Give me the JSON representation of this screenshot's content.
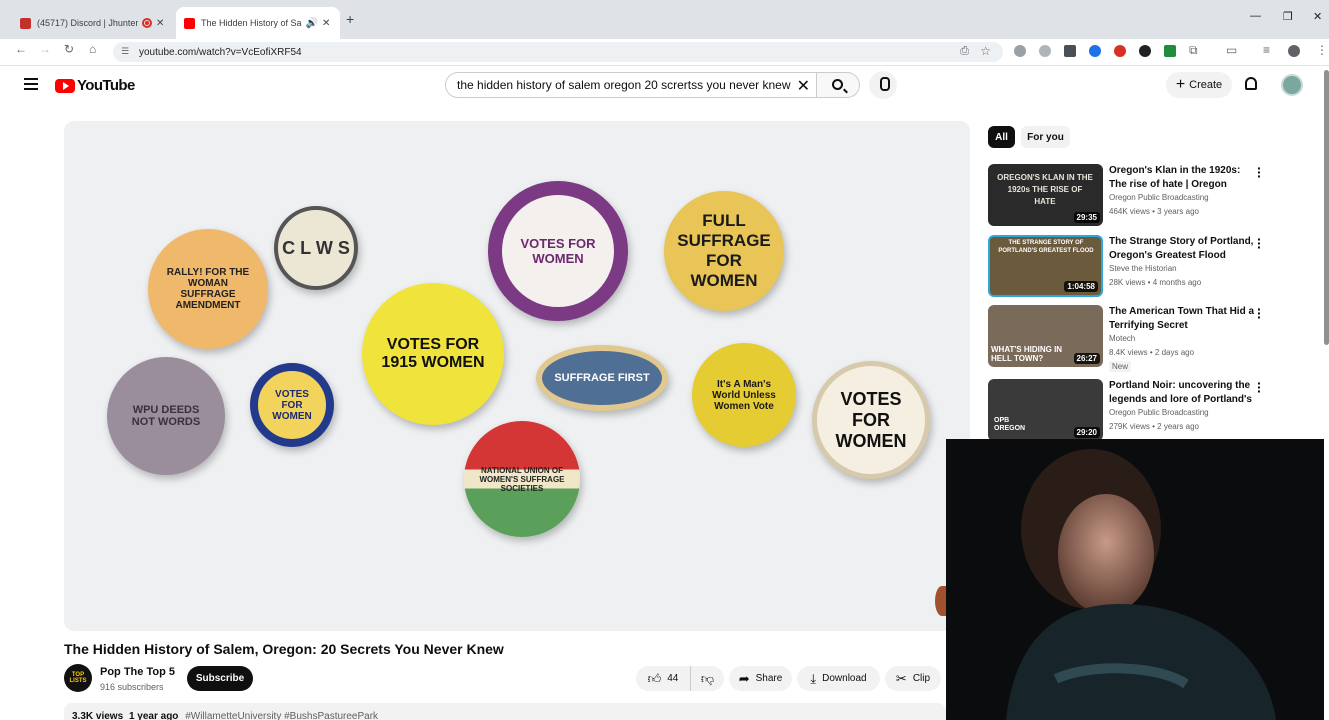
{
  "browser": {
    "tabs": [
      {
        "title": "(45717) Discord | Jhunter, R",
        "active": false
      },
      {
        "title": "The Hidden History of Sale",
        "active": true
      }
    ],
    "url": "youtube.com/watch?v=VcEofiXRF54"
  },
  "header": {
    "logo_text": "YouTube",
    "search_query": "the hidden history of salem oregon 20 scrertss you never knew",
    "create_label": "Create"
  },
  "player": {
    "badges": {
      "rally": "RALLY! FOR THE WOMAN SUFFRAGE AMENDMENT",
      "clws": "C L W S",
      "wspu": "VOTES FOR WOMEN",
      "full": "FULL SUFFRAGE FOR WOMEN",
      "wpu": "WPU DEEDS NOT WORDS",
      "vfw_small": "VOTES FOR WOMEN",
      "y1915": "VOTES FOR 1915 WOMEN",
      "first": "SUFFRAGE FIRST",
      "mans": "It's A Man's World Unless Women Vote",
      "vfw_big": "VOTES FOR WOMEN",
      "nuws": "NATIONAL UNION OF WOMEN'S SUFFRAGE SOCIETIES"
    }
  },
  "video": {
    "title": "The Hidden History of Salem, Oregon: 20 Secrets You Never Knew",
    "channel": "Pop The Top 5",
    "channel_avatar": "TOP LISTS",
    "subscribers": "916 subscribers",
    "subscribe_label": "Subscribe",
    "likes": "44",
    "share_label": "Share",
    "download_label": "Download",
    "clip_label": "Clip",
    "views": "3.3K views",
    "age": "1 year ago",
    "hashtags": "#WillametteUniversity #BushsPastureePark"
  },
  "sidebar": {
    "chips": [
      "All",
      "For you"
    ],
    "items": [
      {
        "title": "Oregon's Klan in the 1920s: The rise of hate | Oregon Experience",
        "channel": "Oregon Public Broadcasting",
        "meta": "464K views • 3 years ago",
        "duration": "29:35",
        "thumb_text": "OREGON'S KLAN IN THE 1920s THE RISE OF HATE"
      },
      {
        "title": "The Strange Story of Portland, Oregon's Greatest Flood",
        "channel": "Steve the Historian",
        "meta": "28K views • 4 months ago",
        "duration": "1:04:58",
        "thumb_text": "THE STRANGE STORY OF PORTLAND'S GREATEST FLOOD"
      },
      {
        "title": "The American Town That Hid a Terrifying Secret",
        "channel": "Motech",
        "meta": "8.4K views • 2 days ago",
        "duration": "26:27",
        "badge": "New",
        "thumb_text": "WHAT'S HIDING IN HELL TOWN?"
      },
      {
        "title": "Portland Noir: uncovering the legends and lore of Portland's ...",
        "channel": "Oregon Public Broadcasting",
        "meta": "279K views • 2 years ago",
        "duration": "29:20",
        "thumb_text": "OPB OREGON"
      }
    ]
  },
  "colors": {
    "brand_red": "#ff0000",
    "text": "#0f0f0f",
    "muted": "#606060",
    "chip_bg": "#f2f2f2"
  }
}
